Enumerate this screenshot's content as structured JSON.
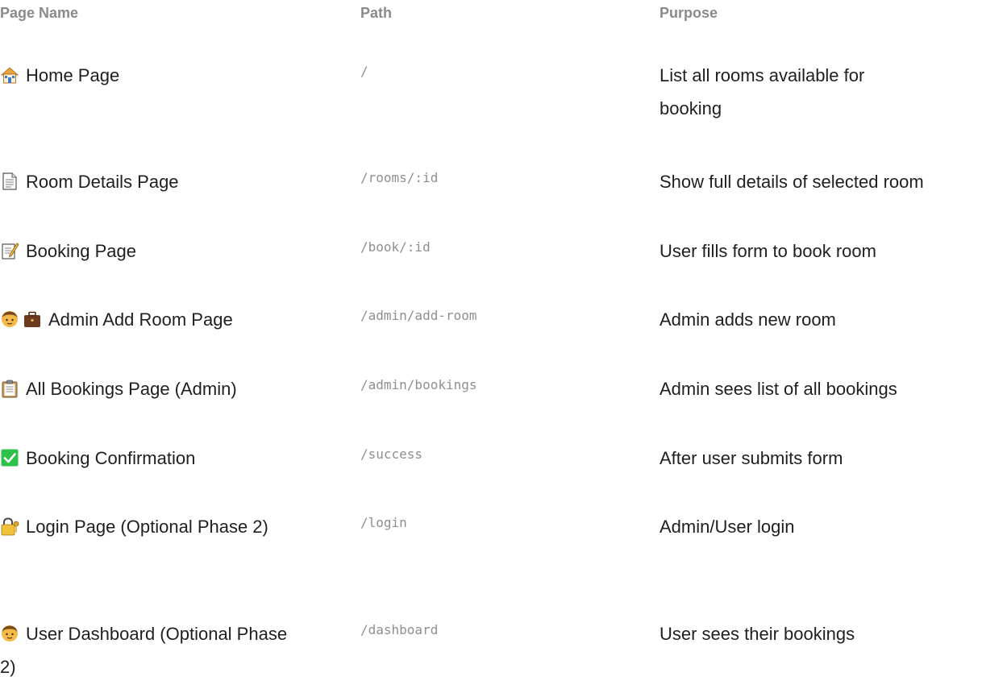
{
  "header": {
    "page_name": "Page Name",
    "path": "Path",
    "purpose": "Purpose"
  },
  "rows": [
    {
      "name": "Home Page",
      "path": "/",
      "purpose": "List all rooms available for booking",
      "icon": "house-icon"
    },
    {
      "name": "Room Details Page",
      "path": "/rooms/:id",
      "purpose": "Show full details of selected room",
      "icon": "document-icon"
    },
    {
      "name": "Booking Page",
      "path": "/book/:id",
      "purpose": "User fills form to book room",
      "icon": "memo-icon"
    },
    {
      "name": "Admin Add Room Page",
      "path": "/admin/add-room",
      "purpose": "Admin adds new room",
      "icon": "person-briefcase-icon"
    },
    {
      "name": "All Bookings Page (Admin)",
      "path": "/admin/bookings",
      "purpose": "Admin sees list of all bookings",
      "icon": "clipboard-icon"
    },
    {
      "name": "Booking Confirmation",
      "path": "/success",
      "purpose": "After user submits form",
      "icon": "check-mark-icon"
    },
    {
      "name": "Login Page (Optional Phase 2)",
      "path": "/login",
      "purpose": "Admin/User login",
      "icon": "lock-key-icon"
    },
    {
      "name": "User Dashboard (Optional Phase 2)",
      "path": "/dashboard",
      "purpose": "User sees their bookings",
      "icon": "person-icon"
    }
  ]
}
